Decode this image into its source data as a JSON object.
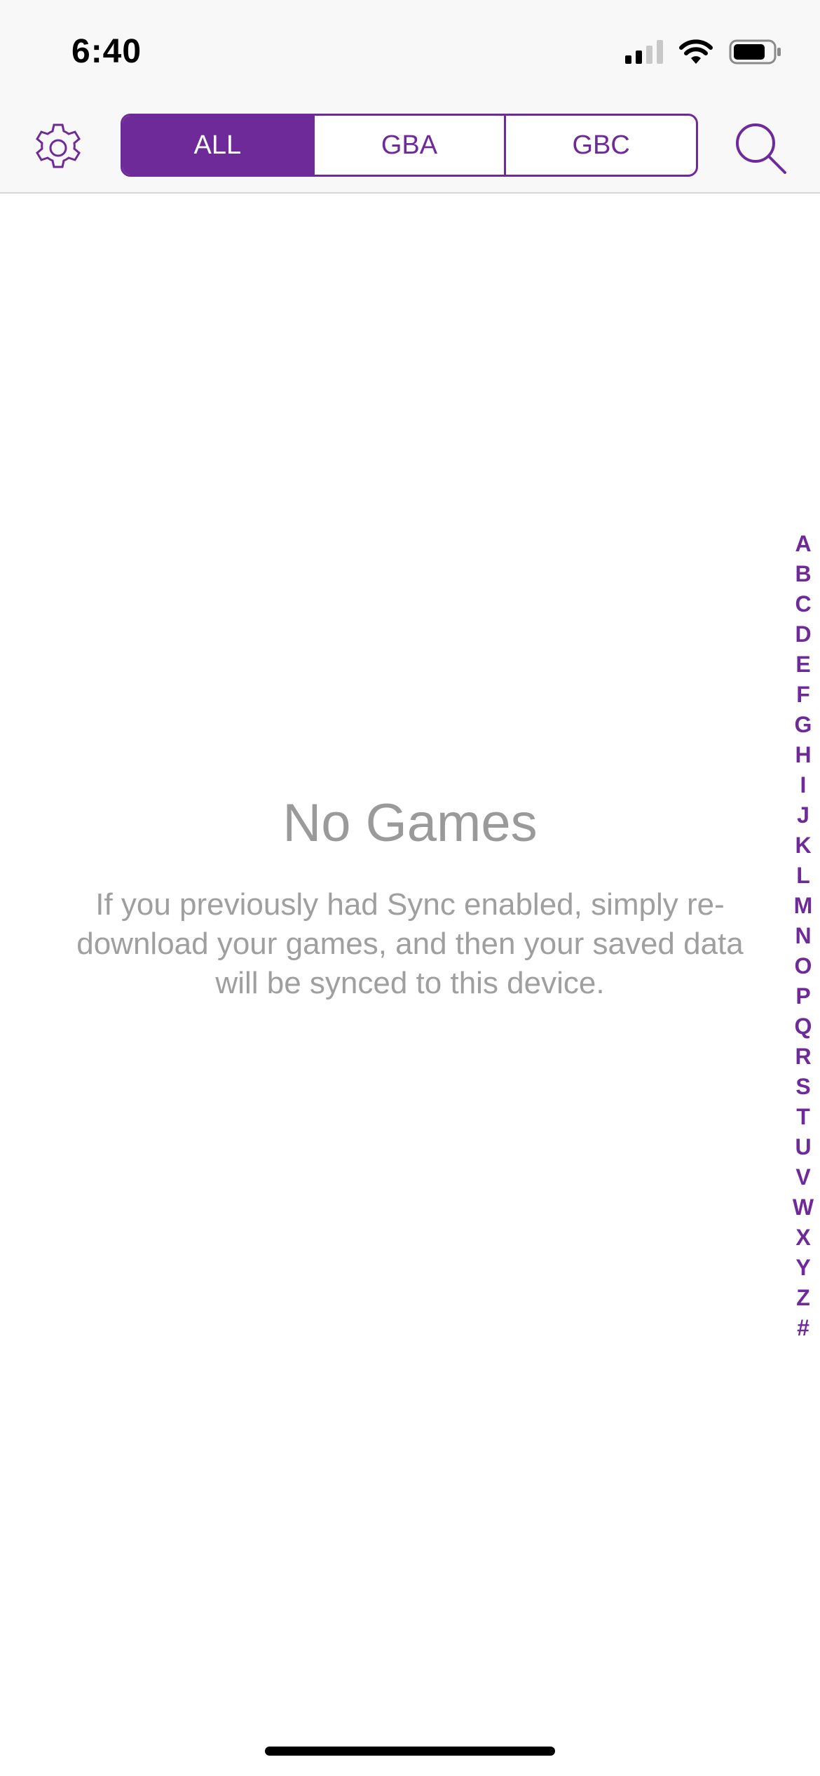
{
  "status_bar": {
    "time": "6:40"
  },
  "nav": {
    "segments": [
      "ALL",
      "GBA",
      "GBC"
    ],
    "selected_segment": "ALL",
    "icons": [
      "gear-icon",
      "search-icon"
    ]
  },
  "empty_state": {
    "title": "No Games",
    "message": "If you previously had Sync enabled, simply re-download your games, and then your saved data will be synced to this device."
  },
  "index_letters": [
    "A",
    "B",
    "C",
    "D",
    "E",
    "F",
    "G",
    "H",
    "I",
    "J",
    "K",
    "L",
    "M",
    "N",
    "O",
    "P",
    "Q",
    "R",
    "S",
    "T",
    "U",
    "V",
    "W",
    "X",
    "Y",
    "Z",
    "#"
  ],
  "colors": {
    "accent": "#6f2a9a",
    "empty_text": "#9a9a9a",
    "bar_background": "#f8f8f8"
  }
}
